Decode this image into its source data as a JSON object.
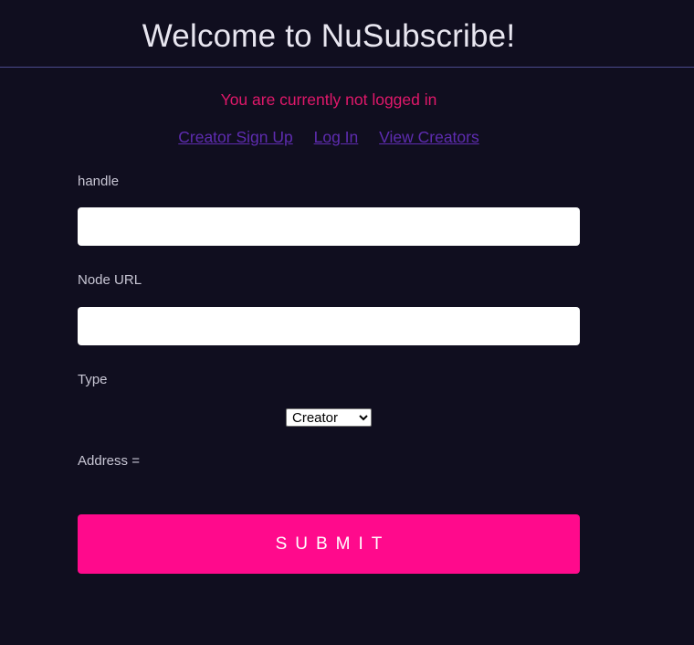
{
  "header": {
    "title": "Welcome to NuSubscribe!"
  },
  "status": {
    "message": "You are currently not logged in"
  },
  "nav": {
    "links": [
      {
        "label": "Creator Sign Up"
      },
      {
        "label": "Log In"
      },
      {
        "label": "View Creators"
      }
    ]
  },
  "form": {
    "handle": {
      "label": "handle",
      "value": ""
    },
    "node_url": {
      "label": "Node URL",
      "value": ""
    },
    "type": {
      "label": "Type",
      "selected": "Creator"
    },
    "address": {
      "label": "Address ="
    },
    "submit_label": "SUBMIT"
  },
  "colors": {
    "background": "#100e1f",
    "accent": "#ff0a8c",
    "status": "#e0186a",
    "link": "#5e2cb0"
  }
}
